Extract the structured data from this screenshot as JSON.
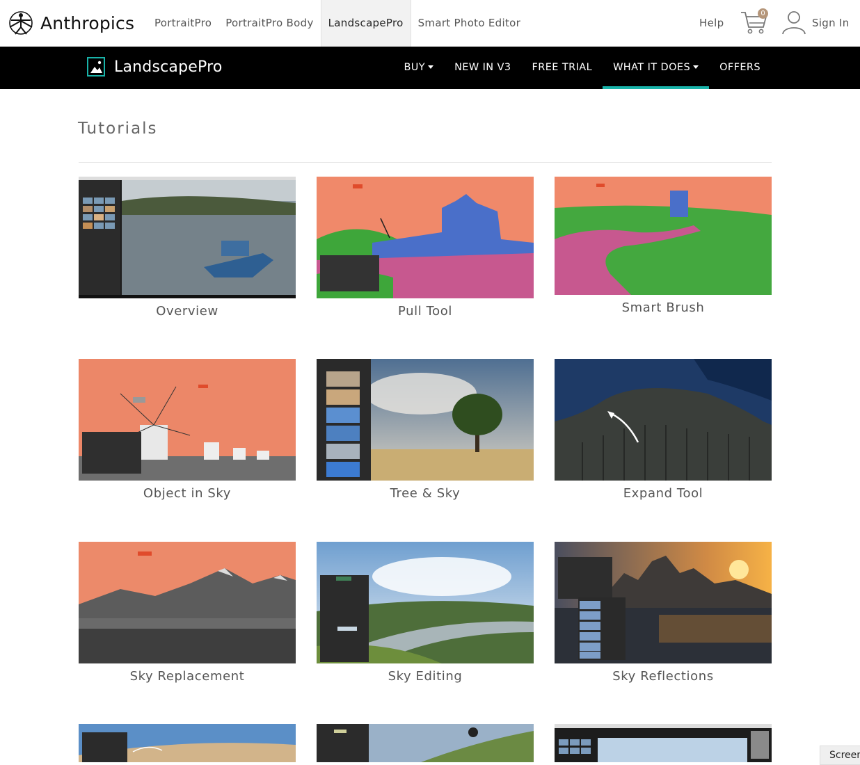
{
  "topbar": {
    "brand": "Anthropics",
    "links": [
      "PortraitPro",
      "PortraitPro Body",
      "LandscapePro",
      "Smart Photo Editor"
    ],
    "active_link": "LandscapePro",
    "help": "Help",
    "cart_count": "0",
    "signin": "Sign In"
  },
  "navbar": {
    "product": "LandscapePro",
    "items": [
      "BUY",
      "NEW IN V3",
      "FREE TRIAL",
      "WHAT IT DOES",
      "OFFERS"
    ],
    "active_item": "WHAT IT DOES",
    "accent": "#19b3a9"
  },
  "main": {
    "title": "Tutorials",
    "tutorials": [
      "Overview",
      "Pull Tool",
      "Smart Brush",
      "Object in Sky",
      "Tree & Sky",
      "Expand Tool",
      "Sky Replacement",
      "Sky Editing",
      "Sky Reflections"
    ]
  },
  "screen_tag": "Screen"
}
